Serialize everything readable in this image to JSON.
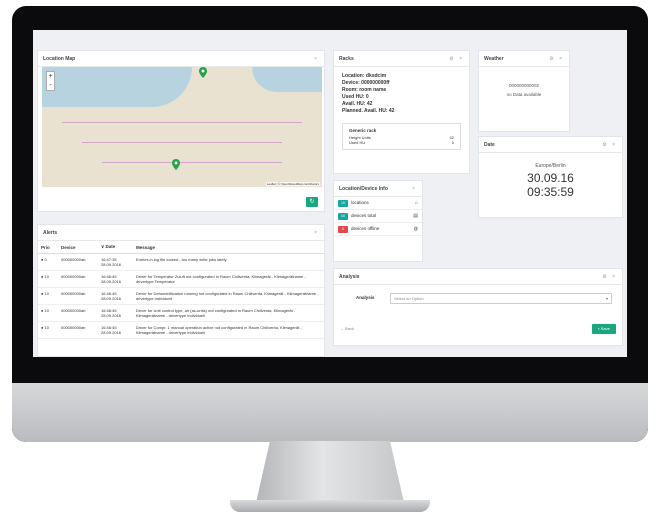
{
  "location_map": {
    "title": "Location Map",
    "close": "×",
    "zoom_in": "+",
    "zoom_out": "-",
    "attribution": "Leaflet | © OpenStreetMap contributors",
    "refresh_icon": "refresh-icon"
  },
  "racks": {
    "title": "Racks",
    "ctrls": "⚙ ×",
    "location": "Location: dksdcim",
    "device": "Device: 000000000ff",
    "room": "Room: room name",
    "used_hu": "Used HU: 0",
    "avail_hu": "Avail. HU: 42",
    "planned_avail_hu": "Planned. Avail. HU: 42",
    "generic_rack_title": "Generic rack",
    "height_units_label": "Height Units",
    "height_units_value": "42",
    "used_hu_label": "Used HU",
    "used_hu_value": "0"
  },
  "weather": {
    "title": "Weather",
    "ctrls": "⚙ ×",
    "id": "000000000002",
    "status": "no Data available"
  },
  "date": {
    "title": "Date",
    "ctrls": "⚙ ×",
    "timezone": "Europe/Berlin",
    "date": "30.09.16",
    "time": "09:35:59"
  },
  "device_info": {
    "title": "Location/Device Info",
    "close": "×",
    "rows": [
      {
        "count": "10",
        "label": "locations",
        "color": "#1aa6a0"
      },
      {
        "count": "10",
        "label": "devices total",
        "color": "#1aa6a0"
      },
      {
        "count": "0",
        "label": "devices offline",
        "color": "#e04a4a"
      }
    ]
  },
  "alerts": {
    "title": "Alerts",
    "close": "×",
    "columns": [
      "Prio",
      "Device",
      "Date",
      "Message"
    ],
    "rows": [
      {
        "prio": "0",
        "device": "000000000ab",
        "date": "16:47:35 28.09.2016",
        "message": "Entries in log file locked - too many write jobs lately."
      },
      {
        "prio": "10",
        "device": "000000000ab",
        "date": "16:46:45 28.09.2016",
        "message": "Driver for Temperatur Zuluft not configurated in Raum Chillventa, Klimagerät - Klimagerätname - drivertype Temperatur"
      },
      {
        "prio": "10",
        "device": "000000000ab",
        "date": "16:46:45 28.09.2016",
        "message": "Driver for Dehumidification running not configurated in Raum Chillventa, Klimagerät - Klimagerätname - drivertype individuell"
      },
      {
        "prio": "10",
        "device": "000000000ab",
        "date": "16:46:45 28.09.2016",
        "message": "Driver for Unit control type, air (ac-units) not configurated in Raum Chillventa, Klimagerät - Klimagerätname - drivertype individuell"
      },
      {
        "prio": "10",
        "device": "000000000ab",
        "date": "16:46:45 28.09.2016",
        "message": "Driver for Compr. 1 manual operation active not configurated in Raum Chillventa, Klimagerät - Klimagerätname - drivertype individuell"
      }
    ]
  },
  "analysis": {
    "title": "Analysis",
    "ctrls": "⚙ ×",
    "label": "Analysis",
    "placeholder": "Select an Option",
    "back": "Back",
    "save": "Save"
  }
}
